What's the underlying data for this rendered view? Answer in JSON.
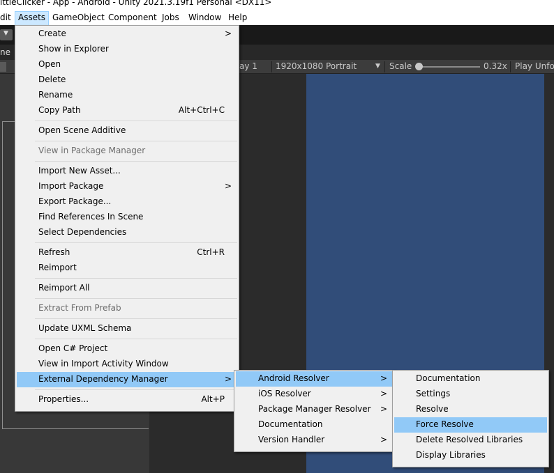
{
  "window": {
    "title": "ittleClicker - App - Android - Unity 2021.3.19f1 Personal <DX11>"
  },
  "menubar": [
    "dit",
    "Assets",
    "GameObject",
    "Component",
    "Jobs",
    "Window",
    "Help"
  ],
  "editor": {
    "tab_fragment": "ne",
    "display_fragment": "ay 1",
    "resolution": "1920x1080 Portrait",
    "scale_label": "Scale",
    "scale_value": "0.32x",
    "play_mode": "Play Unfo"
  },
  "assets_menu": {
    "items": [
      {
        "label": "Create",
        "arrow": ">"
      },
      {
        "label": "Show in Explorer"
      },
      {
        "label": "Open"
      },
      {
        "label": "Delete"
      },
      {
        "label": "Rename"
      },
      {
        "label": "Copy Path",
        "shortcut": "Alt+Ctrl+C"
      },
      {
        "label": "Open Scene Additive"
      },
      {
        "label": "View in Package Manager"
      },
      {
        "label": "Import New Asset..."
      },
      {
        "label": "Import Package",
        "arrow": ">"
      },
      {
        "label": "Export Package..."
      },
      {
        "label": "Find References In Scene"
      },
      {
        "label": "Select Dependencies"
      },
      {
        "label": "Refresh",
        "shortcut": "Ctrl+R"
      },
      {
        "label": "Reimport"
      },
      {
        "label": "Reimport All"
      },
      {
        "label": "Extract From Prefab"
      },
      {
        "label": "Update UXML Schema"
      },
      {
        "label": "Open C# Project"
      },
      {
        "label": "View in Import Activity Window"
      },
      {
        "label": "External Dependency Manager",
        "arrow": ">"
      },
      {
        "label": "Properties...",
        "shortcut": "Alt+P"
      }
    ]
  },
  "edm_menu": {
    "items": [
      {
        "label": "Android Resolver",
        "arrow": ">"
      },
      {
        "label": "iOS Resolver",
        "arrow": ">"
      },
      {
        "label": "Package Manager Resolver",
        "arrow": ">"
      },
      {
        "label": "Documentation"
      },
      {
        "label": "Version Handler",
        "arrow": ">"
      }
    ]
  },
  "android_menu": {
    "items": [
      {
        "label": "Documentation"
      },
      {
        "label": "Settings"
      },
      {
        "label": "Resolve"
      },
      {
        "label": "Force Resolve"
      },
      {
        "label": "Delete Resolved Libraries"
      },
      {
        "label": "Display Libraries"
      }
    ]
  }
}
